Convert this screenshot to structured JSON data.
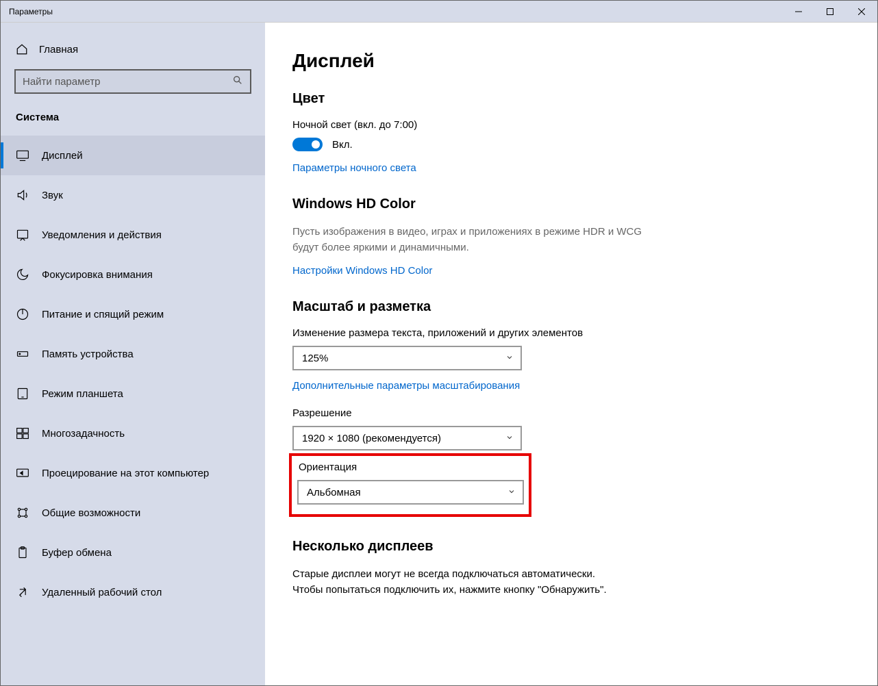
{
  "window": {
    "title": "Параметры"
  },
  "sidebar": {
    "home": "Главная",
    "search_placeholder": "Найти параметр",
    "section": "Система",
    "items": [
      {
        "label": "Дисплей"
      },
      {
        "label": "Звук"
      },
      {
        "label": "Уведомления и действия"
      },
      {
        "label": "Фокусировка внимания"
      },
      {
        "label": "Питание и спящий режим"
      },
      {
        "label": "Память устройства"
      },
      {
        "label": "Режим планшета"
      },
      {
        "label": "Многозадачность"
      },
      {
        "label": "Проецирование на этот компьютер"
      },
      {
        "label": "Общие возможности"
      },
      {
        "label": "Буфер обмена"
      },
      {
        "label": "Удаленный рабочий стол"
      }
    ]
  },
  "content": {
    "title": "Дисплей",
    "color": {
      "heading": "Цвет",
      "night_label": "Ночной свет (вкл. до 7:00)",
      "toggle_state": "Вкл.",
      "link": "Параметры ночного света"
    },
    "hdr": {
      "heading": "Windows HD Color",
      "desc": "Пусть изображения в видео, играх и приложениях в режиме HDR и WCG будут более яркими и динамичными.",
      "link": "Настройки Windows HD Color"
    },
    "scale": {
      "heading": "Масштаб и разметка",
      "size_label": "Изменение размера текста, приложений и других элементов",
      "size_value": "125%",
      "link": "Дополнительные параметры масштабирования",
      "resolution_label": "Разрешение",
      "resolution_value": "1920 × 1080 (рекомендуется)",
      "orientation_label": "Ориентация",
      "orientation_value": "Альбомная"
    },
    "multi": {
      "heading": "Несколько дисплеев",
      "desc1": "Старые дисплеи могут не всегда подключаться автоматически.",
      "desc2": "Чтобы попытаться подключить их, нажмите кнопку \"Обнаружить\"."
    }
  }
}
